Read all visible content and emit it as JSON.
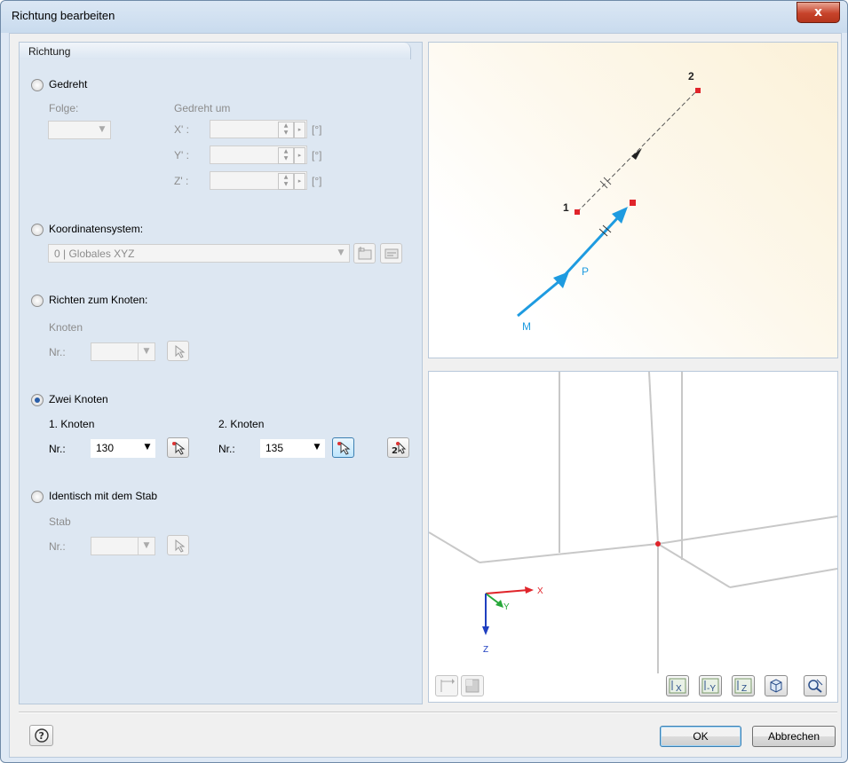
{
  "window": {
    "title": "Richtung bearbeiten",
    "close_glyph": "x"
  },
  "panel": {
    "header": "Richtung",
    "gedreht": {
      "label": "Gedreht",
      "folge_label": "Folge:",
      "folge_value": "",
      "gedreht_um_label": "Gedreht um",
      "axes": [
        {
          "label": "X' :",
          "value": "",
          "unit": "[°]"
        },
        {
          "label": "Y' :",
          "value": "",
          "unit": "[°]"
        },
        {
          "label": "Z' :",
          "value": "",
          "unit": "[°]"
        }
      ]
    },
    "koordinatensystem": {
      "label": "Koordinatensystem:",
      "value": "0 | Globales XYZ"
    },
    "richten": {
      "label": "Richten zum Knoten:",
      "group_label": "Knoten",
      "nr_label": "Nr.:",
      "value": ""
    },
    "zwei_knoten": {
      "label": "Zwei Knoten",
      "first_label": "1. Knoten",
      "first_nr_label": "Nr.:",
      "first_value": "130",
      "second_label": "2. Knoten",
      "second_nr_label": "Nr.:",
      "second_value": "135"
    },
    "identisch": {
      "label": "Identisch mit dem Stab",
      "group_label": "Stab",
      "nr_label": "Nr.:",
      "value": ""
    },
    "selected_option": "Zwei Knoten"
  },
  "preview_top": {
    "node1": "1",
    "node2": "2",
    "label_m": "M",
    "label_p": "P",
    "colors": {
      "arrow": "#1e9be0",
      "node": "#e0242a",
      "dashed": "#555555"
    }
  },
  "preview_bottom": {
    "axis_x": "X",
    "axis_y": "Y",
    "axis_z": "Z",
    "colors": {
      "x": "#e0242a",
      "y": "#27a83a",
      "z": "#1f3fc0"
    },
    "view_buttons": [
      "view-x-icon",
      "view-minus-y-icon",
      "view-z-icon",
      "iso-view-icon",
      "zoom-reset-icon"
    ]
  },
  "footer": {
    "ok": "OK",
    "cancel": "Abbrechen",
    "help_icon": "help-icon"
  }
}
